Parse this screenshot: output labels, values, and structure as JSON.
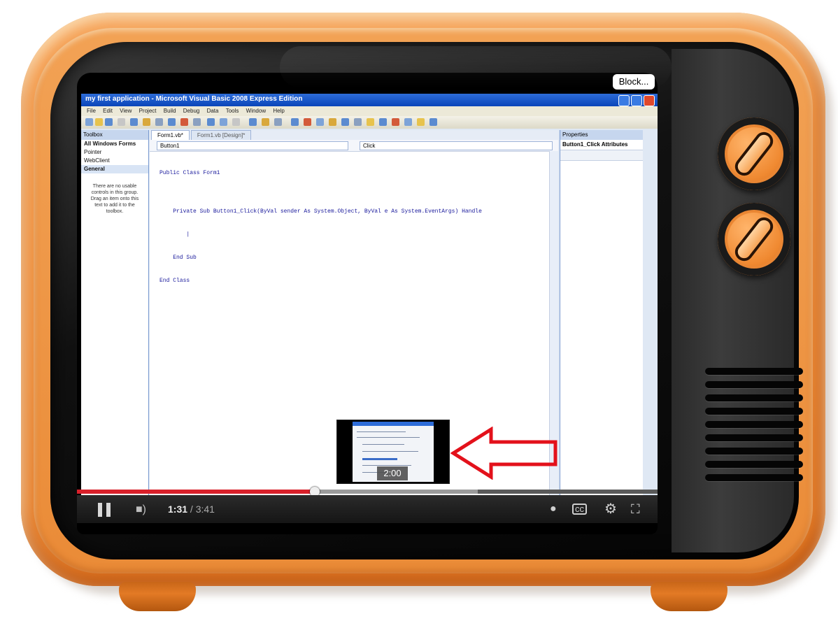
{
  "overlay": {
    "blocked_label": "Block..."
  },
  "vs_window": {
    "title": "my first application - Microsoft Visual Basic 2008 Express Edition",
    "menu": [
      "File",
      "Edit",
      "View",
      "Project",
      "Build",
      "Debug",
      "Data",
      "Tools",
      "Window",
      "Help"
    ],
    "toolbox": {
      "header": "Toolbox",
      "items": [
        "All Windows Forms",
        "Pointer",
        "WebClient",
        "General"
      ],
      "empty_message": "There are no usable controls in this group. Drag an item onto this text to add it to the toolbox."
    },
    "tabs": [
      "Form1.vb*",
      "Form1.vb [Design]*"
    ],
    "object_combo": "Button1",
    "event_combo": "Click",
    "code_lines": [
      "Public Class Form1",
      "",
      "    Private Sub Button1_Click(ByVal sender As System.Object, ByVal e As System.EventArgs) Handle",
      "        |",
      "    End Sub",
      "End Class"
    ],
    "properties": {
      "header": "Properties",
      "object": "Button1_Click Attributes"
    }
  },
  "player": {
    "current_time": "1:31",
    "total_time": "/ 3:41",
    "hover_time": "2:00",
    "progress_played": 0.41,
    "progress_buffered": 0.69,
    "hover_position": 0.547,
    "colors": {
      "played": "#d9202a",
      "arrow": "#e3111b",
      "tv_orange": "#f08a34"
    },
    "icons": [
      "pause-icon",
      "volume-icon",
      "info-icon",
      "captions-icon",
      "settings-icon",
      "fullscreen-icon"
    ]
  }
}
